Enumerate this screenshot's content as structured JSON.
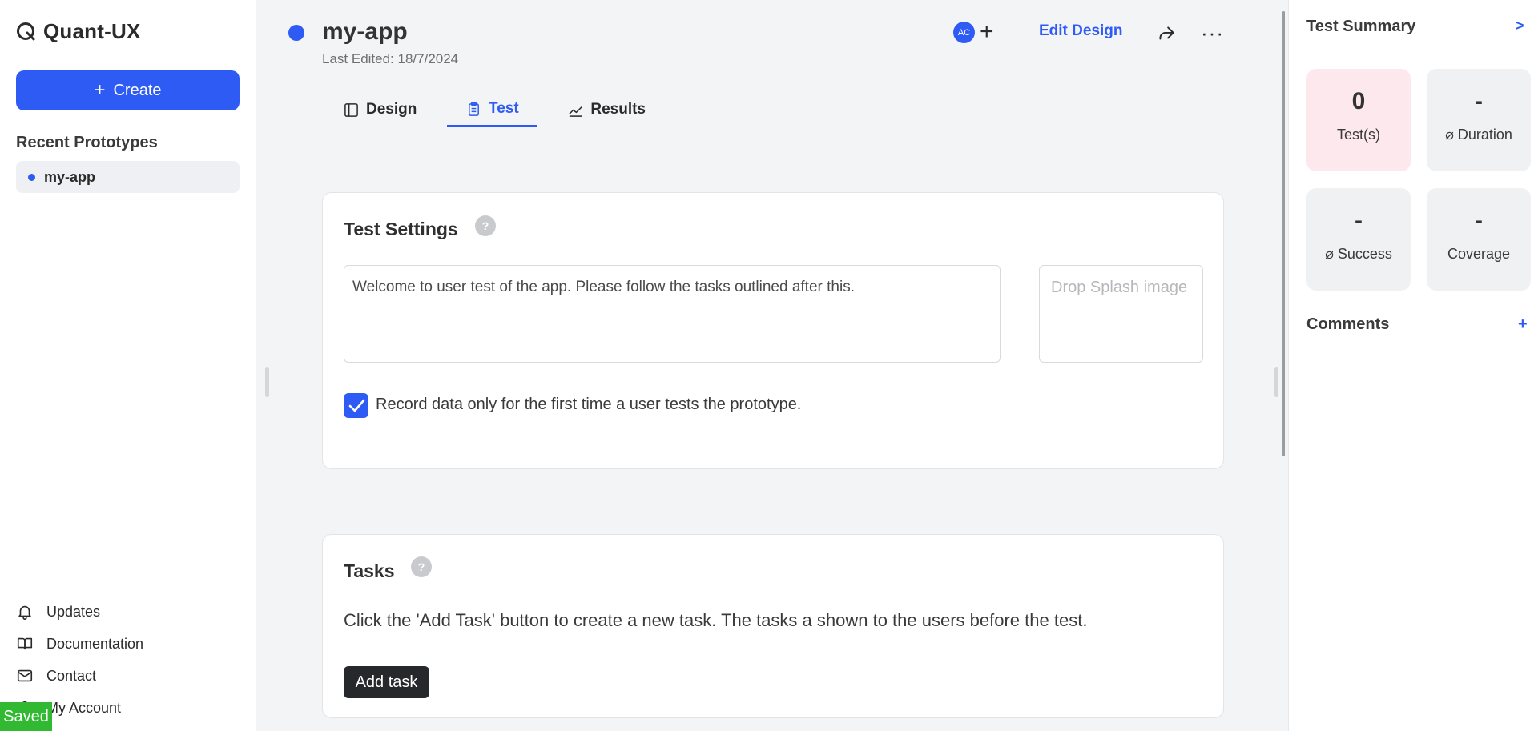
{
  "app": {
    "name": "Quant-UX"
  },
  "sidebar": {
    "create_label": "Create",
    "recent_title": "Recent Prototypes",
    "recent_items": [
      {
        "label": "my-app"
      }
    ],
    "links": [
      {
        "label": "Updates",
        "icon": "bell-icon"
      },
      {
        "label": "Documentation",
        "icon": "book-icon"
      },
      {
        "label": "Contact",
        "icon": "mail-icon"
      },
      {
        "label": "My Account",
        "icon": "user-icon"
      }
    ],
    "saved_label": "Saved"
  },
  "header": {
    "title": "my-app",
    "last_edited": "Last Edited: 18/7/2024",
    "avatar_initials": "AC",
    "add_collaborator": "+",
    "edit_design": "Edit Design",
    "more": "···"
  },
  "tabs": [
    {
      "label": "Design",
      "active": false
    },
    {
      "label": "Test",
      "active": true
    },
    {
      "label": "Results",
      "active": false
    }
  ],
  "test_settings": {
    "title": "Test Settings",
    "help": "?",
    "welcome_text": "Welcome to user test of the app. Please follow the tasks outlined after this.",
    "splash_placeholder": "Drop Splash image",
    "record_checked": true,
    "record_label": "Record data only for the first time a user tests the prototype."
  },
  "tasks": {
    "title": "Tasks",
    "help": "?",
    "description": "Click the 'Add Task' button to create a new task. The tasks a shown to the users before the test.",
    "add_label": "Add task"
  },
  "summary": {
    "title": "Test Summary",
    "expand": ">",
    "stats": [
      {
        "value": "0",
        "label": "Test(s)"
      },
      {
        "value": "-",
        "label": "⌀ Duration"
      },
      {
        "value": "-",
        "label": "⌀ Success"
      },
      {
        "value": "-",
        "label": "Coverage"
      }
    ],
    "comments_title": "Comments",
    "comments_add": "+"
  },
  "colors": {
    "accent": "#2f5bf5",
    "saved": "#31b931",
    "tests_card": "#fde8ee"
  }
}
